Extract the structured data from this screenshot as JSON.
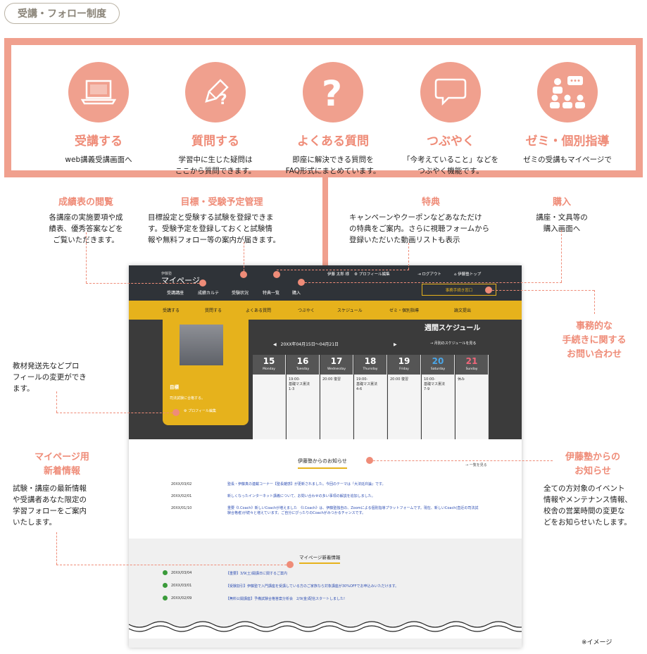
{
  "tag": "受講・フォロー制度",
  "features": [
    {
      "icon": "laptop-icon",
      "title": "受講する",
      "desc": [
        "web講義受講画面へ"
      ]
    },
    {
      "icon": "pencil-question-icon",
      "title": "質問する",
      "desc": [
        "学習中に生じた疑問は",
        "ここから質問できます。"
      ]
    },
    {
      "icon": "question-icon",
      "title": "よくある質問",
      "desc": [
        "即座に解決できる質問を",
        "FAQ形式にまとめています。"
      ]
    },
    {
      "icon": "speech-bubble-icon",
      "title": "つぶやく",
      "desc": [
        "「今考えていること」などを",
        "つぶやく機能です。"
      ]
    },
    {
      "icon": "seminar-icon",
      "title": "ゼミ・個別指導",
      "desc": [
        "ゼミの受講もマイページで"
      ]
    }
  ],
  "annotations": {
    "grades": {
      "title": "成績表の閲覧",
      "desc": [
        "各講座の実施要項や成",
        "績表、優秀答案などを",
        "ご覧いただきます。"
      ]
    },
    "goals": {
      "title": "目標・受験予定管理",
      "desc": [
        "目標設定と受験する試験を登録できま",
        "す。受験予定を登録しておくと試験情",
        "報や無料フォロー等の案内が届きます。"
      ]
    },
    "perks": {
      "title": "特典",
      "desc": [
        "キャンペーンやクーポンなどあなただけ",
        "の特典をご案内。さらに視聴フォームから",
        "登録いただいた動画リストも表示"
      ]
    },
    "purchase": {
      "title": "購入",
      "desc": [
        "講座・文具等の",
        "購入画面へ"
      ]
    },
    "office": {
      "title": "事務的な\n手続きに関する\nお問い合わせ",
      "lines": [
        "事務的な",
        "手続きに関する",
        "お問い合わせ"
      ]
    },
    "profile": {
      "desc": [
        "教材発送先などプロ",
        "フィールの変更ができ",
        "ます。"
      ]
    },
    "mypage_news": {
      "lines": [
        "マイページ用",
        "新着情報"
      ],
      "desc": [
        "試験・講座の最新情報",
        "や受講者あなた限定の",
        "学習フォローをご案内",
        "いたします。"
      ]
    },
    "itojuku_news": {
      "lines": [
        "伊藤塾からの",
        "お知らせ"
      ],
      "desc": [
        "全ての方対象のイベント",
        "情報やメンテナンス情報、",
        "校舎の営業時間の変更な",
        "どをお知らせいたします。"
      ]
    }
  },
  "screen": {
    "brand_small": "伊藤塾",
    "brand": "マイページ",
    "user": "伊藤 太郎 様",
    "header_links": [
      "プロフィール編集",
      "ログアウト",
      "伊藤塾トップ"
    ],
    "nav": [
      "受講講座",
      "成績カルテ",
      "受験状況",
      "特典一覧",
      "購入"
    ],
    "contact": "事務手続き窓口",
    "yellow_nav": [
      "受講する",
      "質問する",
      "よくある質問",
      "つぶやく",
      "スケジュール",
      "ゼミ・個別指導",
      "論文提出"
    ],
    "profile_title": "目標",
    "profile_text": "司法試験に合格する。",
    "profile_edit": "プロフィール編集",
    "schedule_title": "週間スケジュール",
    "schedule_range": "20XX年04月15日～04月21日",
    "schedule_month": "月別のスケジュールを見る",
    "days": [
      {
        "num": "15",
        "name": "Monday",
        "events": []
      },
      {
        "num": "16",
        "name": "Tuesday",
        "events": [
          "19:00-",
          "基礎マス憲法",
          "1-3"
        ]
      },
      {
        "num": "17",
        "name": "Wednesday",
        "events": [
          "20:00 復習"
        ]
      },
      {
        "num": "18",
        "name": "Thursday",
        "events": [
          "19:00-",
          "基礎マス憲法",
          "4-6"
        ]
      },
      {
        "num": "19",
        "name": "Friday",
        "events": [
          "20:00 復習"
        ]
      },
      {
        "num": "20",
        "name": "Saturday",
        "events": [
          "10:00-",
          "基礎マス憲法",
          "7-9"
        ]
      },
      {
        "num": "21",
        "name": "Sunday",
        "events": [
          "休み"
        ]
      }
    ],
    "news_title": "伊藤塾からのお知らせ",
    "news_more": "一覧を見る",
    "news": [
      {
        "date": "20XX/03/02",
        "text": "塾長・伊藤真の連載コーナー【塾長雑感】が更新されました。今回のテーマは『大法廷弁論』です。"
      },
      {
        "date": "20XX/02/01",
        "text": "新しくなったインターネット講義について、お問い合わせの多い事項の解説を追加しました。"
      },
      {
        "date": "20XX/01/10",
        "text": "重要《I.Coach》新しいCoachが増えました　《I.Coach》は、伊藤塾独自の、Zoomによる個別指導プラットフォームです。現在、新しいCoach(直近の司法試験合格者)が続々と増えています。ご自分にぴったりのCoachがみつかるチャンスです。"
      }
    ],
    "mynews_title": "マイページ新着情報",
    "mynews": [
      {
        "date": "20XX/03/04",
        "text": "【重要】3/9(土)開講日に関するご案内"
      },
      {
        "date": "20XX/03/01",
        "text": "【受験割引】伊藤塾で入門講座を受講している方のご家族なら対象講座が30%OFFでお申込みいただけます。"
      },
      {
        "date": "20XX/02/09",
        "text": "【無料公開講座】予備試験合格答案分析会　2/9(金)配信スタートしました!"
      }
    ]
  },
  "image_note": "※イメージ"
}
